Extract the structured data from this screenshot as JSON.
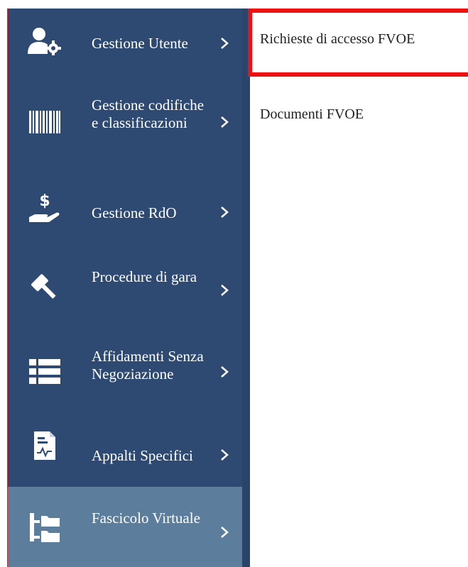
{
  "sidebar": {
    "items": [
      {
        "label": "Gestione Utente",
        "icon": "user-settings-icon"
      },
      {
        "label": "Gestione codifiche e classificazioni",
        "icon": "barcode-icon"
      },
      {
        "label": "Gestione RdO",
        "icon": "hand-dollar-icon"
      },
      {
        "label": "Procedure di gara",
        "icon": "gavel-icon"
      },
      {
        "label": "Affidamenti Senza Negoziazione",
        "icon": "list-icon"
      },
      {
        "label": "Appalti Specifici",
        "icon": "document-chart-icon"
      },
      {
        "label": "Fascicolo Virtuale",
        "icon": "folder-tree-icon"
      }
    ]
  },
  "submenu": {
    "items": [
      {
        "label": "Richieste di accesso FVOE"
      },
      {
        "label": "Documenti FVOE"
      }
    ]
  },
  "colors": {
    "sidebar_bg": "#2e4a72",
    "active_bg": "#5c7d9c",
    "highlight_border": "#ee1111"
  }
}
